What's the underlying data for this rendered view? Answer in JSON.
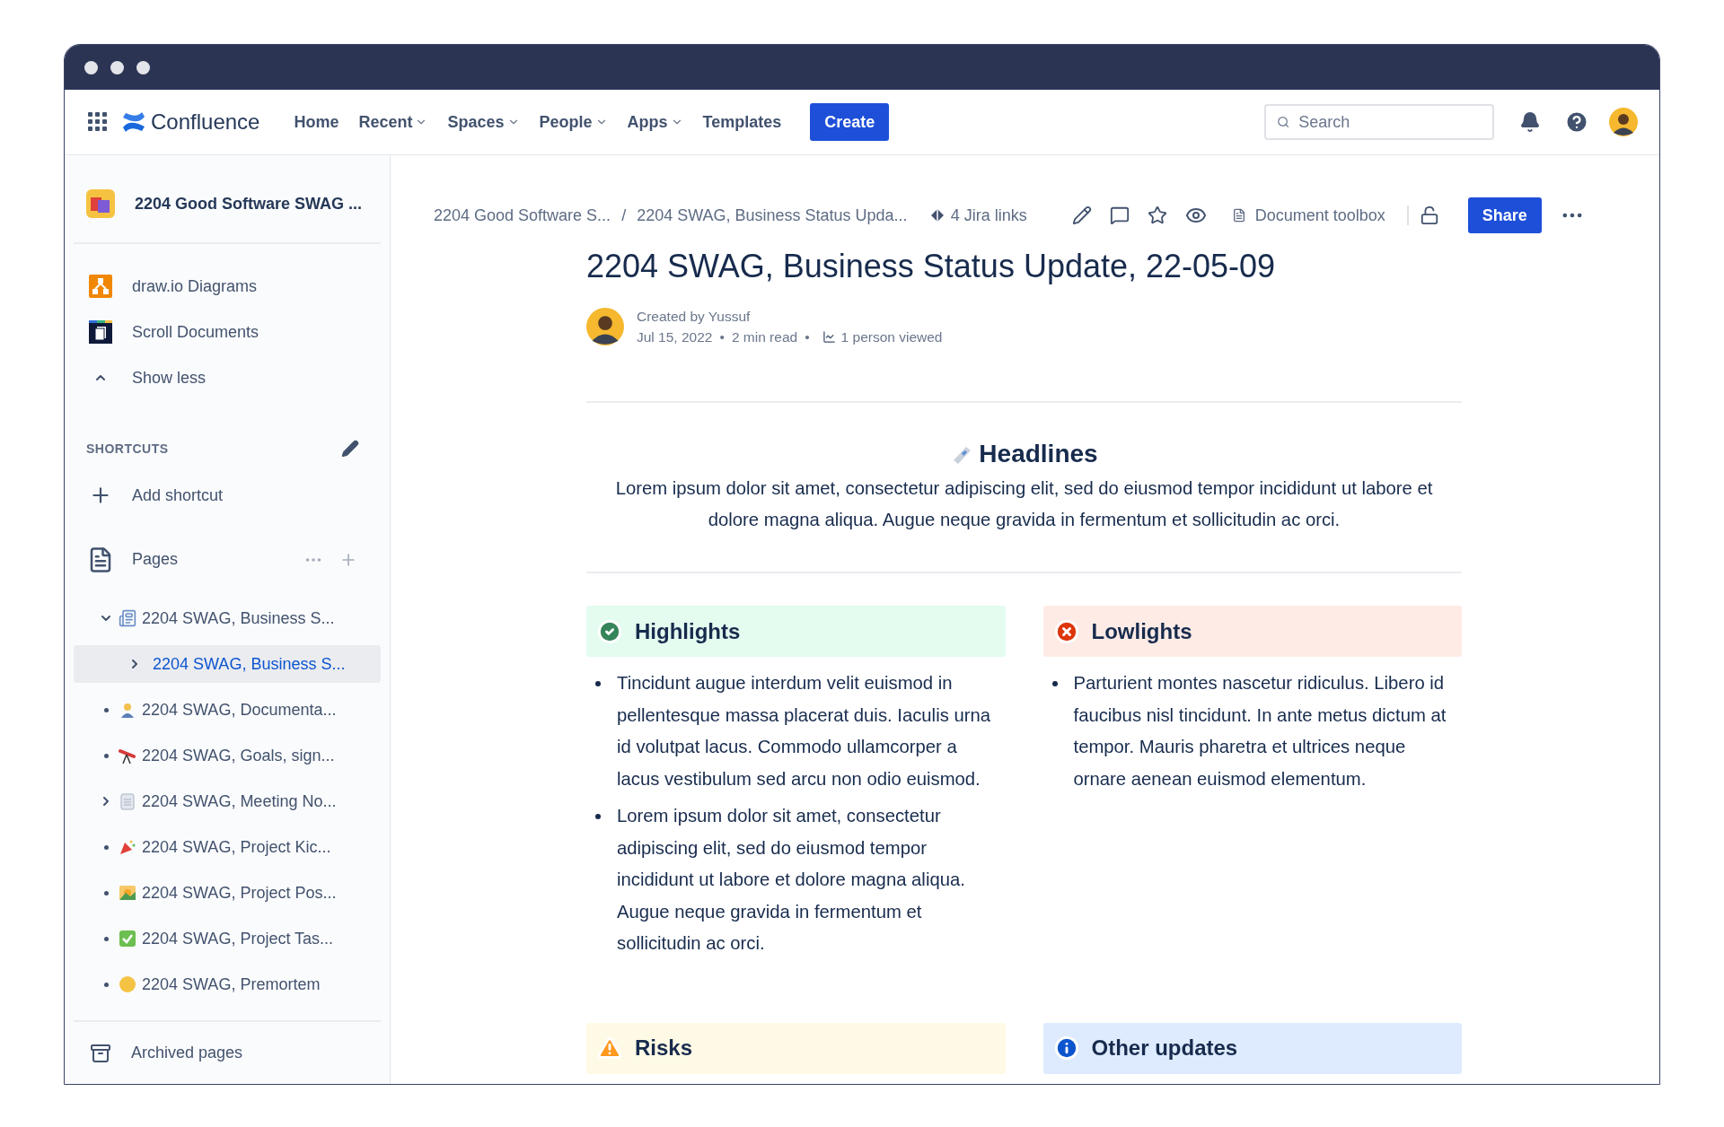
{
  "nav": {
    "app_name": "Confluence",
    "links": [
      {
        "label": "Home",
        "dropdown": false
      },
      {
        "label": "Recent",
        "dropdown": true
      },
      {
        "label": "Spaces",
        "dropdown": true
      },
      {
        "label": "People",
        "dropdown": true
      },
      {
        "label": "Apps",
        "dropdown": true
      },
      {
        "label": "Templates",
        "dropdown": false
      }
    ],
    "create_button": "Create",
    "search": {
      "placeholder": "Search"
    }
  },
  "sidebar": {
    "space_name": "2204 Good Software SWAG ...",
    "apps": [
      {
        "label": "draw.io Diagrams"
      },
      {
        "label": "Scroll Documents"
      }
    ],
    "show_less": "Show less",
    "shortcuts": {
      "heading": "SHORTCUTS",
      "add": "Add shortcut"
    },
    "pages": {
      "heading": "Pages",
      "tree": [
        {
          "label": "2204 SWAG, Business S...",
          "selected": false,
          "expanded": true,
          "children": [
            {
              "label": "2204 SWAG, Business S...",
              "selected": true,
              "expanded": false
            }
          ]
        },
        {
          "label": "2204 SWAG, Documenta...",
          "selected": false
        },
        {
          "label": "2204 SWAG, Goals, sign...",
          "selected": false
        },
        {
          "label": "2204 SWAG, Meeting No...",
          "selected": false,
          "expanded": false
        },
        {
          "label": "2204 SWAG, Project Kic...",
          "selected": false
        },
        {
          "label": "2204 SWAG, Project Pos...",
          "selected": false
        },
        {
          "label": "2204 SWAG, Project Tas...",
          "selected": false
        },
        {
          "label": "2204 SWAG, Premortem",
          "selected": false
        }
      ]
    },
    "archived": "Archived pages"
  },
  "page": {
    "breadcrumbs": [
      "2204 Good Software S...",
      "2204 SWAG, Business Status Upda..."
    ],
    "breadcrumb_separator": "/",
    "jira_links": "4 Jira links",
    "toolbox": "Document toolbox",
    "share": "Share",
    "title": "2204 SWAG, Business Status Update, 22-05-09",
    "byline": "Created by Yussuf",
    "meta": [
      {
        "kind": "text",
        "text": "Jul 15, 2022"
      },
      {
        "kind": "dot",
        "text": "•"
      },
      {
        "kind": "text",
        "text": "2 min read"
      },
      {
        "kind": "dot",
        "text": "•"
      },
      {
        "kind": "views",
        "text": "1 person viewed"
      }
    ],
    "headline": {
      "title": "Headlines",
      "text": "Lorem ipsum dolor sit amet, consectetur adipiscing elit, sed do eiusmod tempor incididunt ut labore et dolore magna aliqua. Augue neque gravida in fermentum et sollicitudin ac orci."
    },
    "panels": [
      {
        "kind": "success",
        "title": "Highlights",
        "items": [
          "Tincidunt augue interdum velit euismod in pellentesque massa placerat duis. Iaculis urna id volutpat lacus. Commodo ullamcorper a lacus vestibulum sed arcu non odio euismod.",
          "Lorem ipsum dolor sit amet, consectetur adipiscing elit, sed do eiusmod tempor incididunt ut labore et dolore magna aliqua. Augue neque gravida in fermentum et sollicitudin ac orci."
        ]
      },
      {
        "kind": "error",
        "title": "Lowlights",
        "items": [
          "Parturient montes nascetur ridiculus. Libero id faucibus nisl tincidunt. In ante metus dictum at tempor. Mauris pharetra et ultrices neque ornare aenean euismod elementum."
        ]
      },
      {
        "kind": "warning",
        "title": "Risks"
      },
      {
        "kind": "info",
        "title": "Other updates"
      }
    ]
  }
}
